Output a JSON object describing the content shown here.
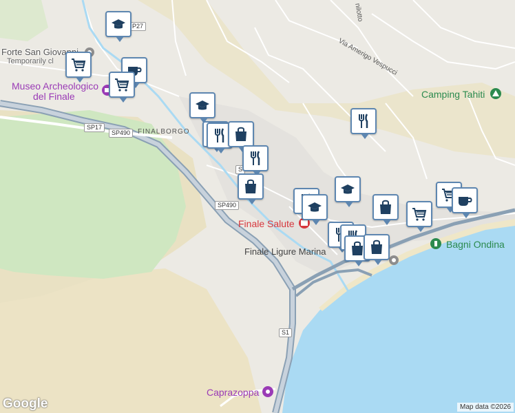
{
  "map": {
    "colors": {
      "sea": "#aadaf3",
      "land": "#eceae4",
      "park": "#cfe7c1",
      "sand": "#ece3c5",
      "road": "#ffffff",
      "highway": "#8aa0b4",
      "marker_border": "#5d86b0",
      "marker_icon": "#1f4061"
    },
    "places": [
      {
        "name": "Forte San Giovanni",
        "note": "Temporarily cl",
        "type": "landmark"
      },
      {
        "name": "Museo Archeologico del Finale",
        "line1": "Museo Archeologico",
        "line2": "del Finale",
        "type": "museum"
      },
      {
        "name": "Camping Tahiti",
        "type": "camping"
      },
      {
        "name": "Finale Salute",
        "type": "hospital"
      },
      {
        "name": "Bagni Ondina",
        "type": "beach"
      },
      {
        "name": "Caprazoppa",
        "type": "attraction"
      }
    ],
    "areas": [
      "FINALBORGO",
      "Finale Ligure Marina"
    ],
    "streets": [
      "Via Amerigo Vespucci",
      "nilotto"
    ],
    "road_shields": [
      "SP17",
      "SP490",
      "SP490",
      "S",
      "S1",
      "P27"
    ],
    "markers": [
      {
        "icon": "school-icon"
      },
      {
        "icon": "grocery-icon"
      },
      {
        "icon": "cafe-icon"
      },
      {
        "icon": "grocery-icon"
      },
      {
        "icon": "school-icon"
      },
      {
        "icon": "restaurant-icon"
      },
      {
        "icon": "restaurant-icon"
      },
      {
        "icon": "shopping-icon"
      },
      {
        "icon": "restaurant-icon"
      },
      {
        "icon": "restaurant-icon"
      },
      {
        "icon": "shopping-icon"
      },
      {
        "icon": "restaurant-icon"
      },
      {
        "icon": "school-icon"
      },
      {
        "icon": "school-icon"
      },
      {
        "icon": "shopping-icon"
      },
      {
        "icon": "grocery-icon"
      },
      {
        "icon": "grocery-icon"
      },
      {
        "icon": "cafe-icon"
      },
      {
        "icon": "restaurant-icon"
      },
      {
        "icon": "restaurant-icon"
      },
      {
        "icon": "shopping-icon"
      },
      {
        "icon": "shopping-icon"
      }
    ],
    "attribution": "Map data ©2026",
    "logo": "Google"
  }
}
